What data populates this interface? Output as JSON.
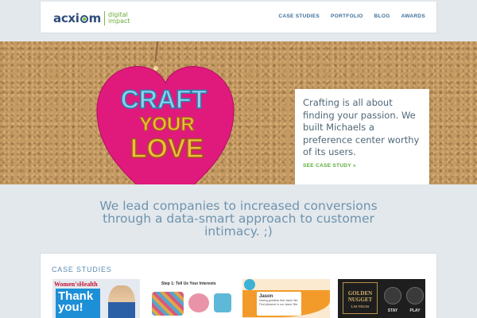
{
  "header": {
    "logo": {
      "wordmark": "acxiom",
      "sub_line1": "digital",
      "sub_line2": "impact"
    },
    "nav": [
      "CASE STUDIES",
      "PORTFOLIO",
      "BLOG",
      "AWARDS"
    ]
  },
  "hero": {
    "heart_text": {
      "line1": "CRAFT",
      "line2": "YOUR",
      "line3": "LOVE"
    },
    "callout_text": "Crafting is all about finding your passion. We built Michaels a preference center worthy of its users.",
    "callout_link": "SEE CASE STUDY »",
    "slide_count": 3,
    "active_slide": 2,
    "colors": {
      "heart": "#e0197d",
      "accent_green": "#6cc04a"
    }
  },
  "tagline": {
    "line1": "We lead companies to increased conversions",
    "line2": "through a data-smart approach to customer",
    "line3": "intimacy. ;)"
  },
  "case_studies": {
    "title": "CASE STUDIES",
    "thumbs": [
      {
        "masthead": "Women'sHealth",
        "headline": "Thank you!"
      },
      {
        "step": "Step 1: Tell Us Your Interests"
      },
      {
        "name": "Jason",
        "line1": "Having goddess that Jason like",
        "line2": "Find pleasure in our Jason Site"
      },
      {
        "sign_line1": "GOLDEN",
        "sign_line2": "NUGGET",
        "sign_line3": "LAS VEGAS",
        "btn1": "STAY",
        "btn2": "PLAY"
      }
    ]
  }
}
